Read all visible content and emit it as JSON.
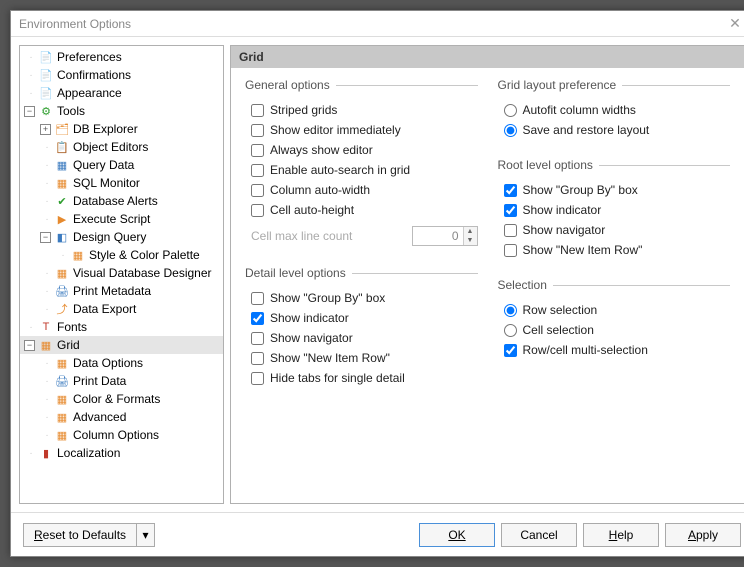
{
  "window": {
    "title": "Environment Options"
  },
  "tree": {
    "items": [
      {
        "label": "Preferences",
        "depth": 1,
        "toggle": "",
        "icon": "📄",
        "color": "#e68a2e"
      },
      {
        "label": "Confirmations",
        "depth": 1,
        "toggle": "",
        "icon": "📄",
        "color": "#e68a2e"
      },
      {
        "label": "Appearance",
        "depth": 1,
        "toggle": "",
        "icon": "📄",
        "color": "#e68a2e"
      },
      {
        "label": "Tools",
        "depth": 1,
        "toggle": "-",
        "icon": "⚙",
        "color": "#2e9e2e"
      },
      {
        "label": "DB Explorer",
        "depth": 2,
        "toggle": "+",
        "icon": "🗂",
        "color": "#e68a2e"
      },
      {
        "label": "Object Editors",
        "depth": 2,
        "toggle": "",
        "icon": "📋",
        "color": "#e68a2e"
      },
      {
        "label": "Query Data",
        "depth": 2,
        "toggle": "",
        "icon": "▦",
        "color": "#3a7abf"
      },
      {
        "label": "SQL Monitor",
        "depth": 2,
        "toggle": "",
        "icon": "▦",
        "color": "#e68a2e"
      },
      {
        "label": "Database Alerts",
        "depth": 2,
        "toggle": "",
        "icon": "✔",
        "color": "#2e9e2e"
      },
      {
        "label": "Execute Script",
        "depth": 2,
        "toggle": "",
        "icon": "▶",
        "color": "#e68a2e"
      },
      {
        "label": "Design Query",
        "depth": 2,
        "toggle": "-",
        "icon": "◧",
        "color": "#3a7abf"
      },
      {
        "label": "Style & Color Palette",
        "depth": 3,
        "toggle": "",
        "icon": "▦",
        "color": "#e68a2e"
      },
      {
        "label": "Visual Database Designer",
        "depth": 2,
        "toggle": "",
        "icon": "▦",
        "color": "#e68a2e"
      },
      {
        "label": "Print Metadata",
        "depth": 2,
        "toggle": "",
        "icon": "🖨",
        "color": "#3a7abf"
      },
      {
        "label": "Data Export",
        "depth": 2,
        "toggle": "",
        "icon": "⤴",
        "color": "#e68a2e"
      },
      {
        "label": "Fonts",
        "depth": 1,
        "toggle": "",
        "icon": "T",
        "color": "#c0392b"
      },
      {
        "label": "Grid",
        "depth": 1,
        "toggle": "-",
        "icon": "▦",
        "color": "#e68a2e",
        "selected": true
      },
      {
        "label": "Data Options",
        "depth": 2,
        "toggle": "",
        "icon": "▦",
        "color": "#e68a2e"
      },
      {
        "label": "Print Data",
        "depth": 2,
        "toggle": "",
        "icon": "🖨",
        "color": "#3a7abf"
      },
      {
        "label": "Color & Formats",
        "depth": 2,
        "toggle": "",
        "icon": "▦",
        "color": "#e68a2e"
      },
      {
        "label": "Advanced",
        "depth": 2,
        "toggle": "",
        "icon": "▦",
        "color": "#e68a2e"
      },
      {
        "label": "Column Options",
        "depth": 2,
        "toggle": "",
        "icon": "▦",
        "color": "#e68a2e"
      },
      {
        "label": "Localization",
        "depth": 1,
        "toggle": "",
        "icon": "▮",
        "color": "#c0392b"
      }
    ]
  },
  "panel": {
    "title": "Grid",
    "general": {
      "legend": "General options",
      "striped_label": "Striped grids",
      "show_editor_label": "Show editor immediately",
      "always_show_label": "Always show editor",
      "auto_search_label": "Enable auto-search in grid",
      "col_autowidth_label": "Column auto-width",
      "cell_autoheight_label": "Cell auto-height",
      "cell_max_label": "Cell max line count",
      "cell_max_value": "0"
    },
    "detail": {
      "legend": "Detail level options",
      "groupby_label": "Show \"Group By\" box",
      "indicator_label": "Show indicator",
      "navigator_label": "Show navigator",
      "newitem_label": "Show \"New Item Row\"",
      "hidetabs_label": "Hide tabs for single detail"
    },
    "layout": {
      "legend": "Grid layout preference",
      "autofit_label": "Autofit column widths",
      "save_label": "Save and restore layout"
    },
    "root": {
      "legend": "Root level options",
      "groupby_label": "Show \"Group By\" box",
      "indicator_label": "Show indicator",
      "navigator_label": "Show navigator",
      "newitem_label": "Show \"New Item Row\""
    },
    "selection": {
      "legend": "Selection",
      "row_label": "Row selection",
      "cell_label": "Cell selection",
      "multi_label": "Row/cell multi-selection"
    }
  },
  "buttons": {
    "reset": "Reset to Defaults",
    "ok": "OK",
    "cancel": "Cancel",
    "help": "Help",
    "apply": "Apply"
  }
}
